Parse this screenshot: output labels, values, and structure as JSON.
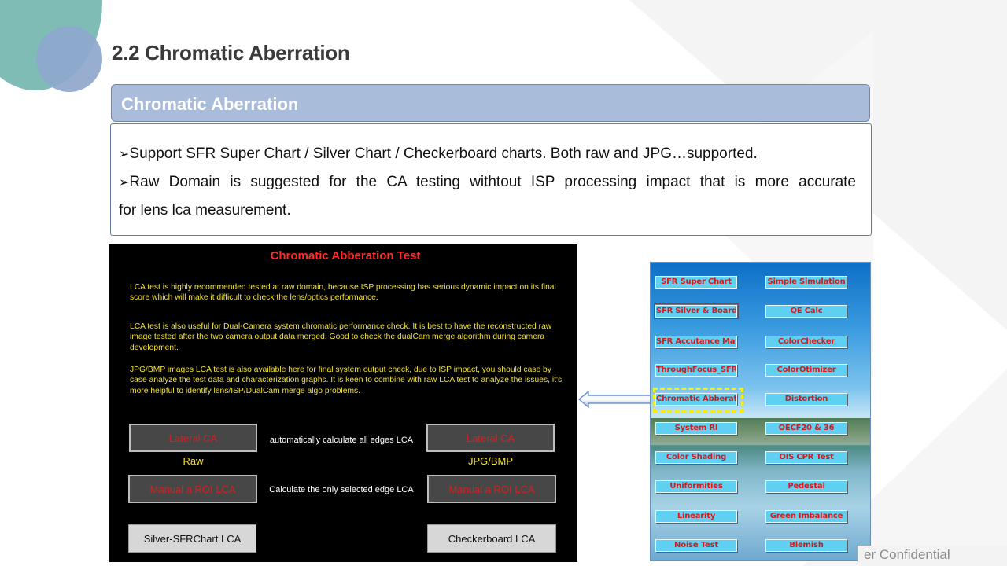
{
  "slide": {
    "title": "2.2  Chromatic Aberration",
    "section_header": "Chromatic Aberration",
    "bullets": [
      "Support SFR Super Chart / Silver Chart / Checkerboard charts. Both raw and JPG…supported.",
      "Raw Domain is suggested for the CA testing withtout ISP processing impact that is more accurate",
      "for lens lca measurement."
    ],
    "bullet_glyph": "➢",
    "footer_text": "er Confidential"
  },
  "app": {
    "title": "Chromatic Abberation Test",
    "paragraphs": [
      "LCA test is highly recommended tested at raw domain, because ISP processing has serious dynamic impact on its final score which will make it difficult to check the lens/optics performance.",
      "LCA test is also useful for Dual-Camera system chromatic performance check. It is best to have the reconstructed raw image tested after the two camera output data merged. Good to check the dualCam merge algorithm during camera development.",
      "JPG/BMP images LCA test is also available here for final system output check, due to ISP impact, you should case by case analyze the test data and characterization graphs.  It is keen to combine with raw LCA test to analyze the issues, it's more helpful to identify lens/ISP/DualCam merge algo problems."
    ],
    "buttons": {
      "lateral_raw": "Lateral CA",
      "lateral_jpg": "Lateral CA",
      "manual_raw": "Manual a ROI LCA",
      "manual_jpg": "Manual a ROI LCA",
      "silver": "Silver-SFRChart LCA",
      "checkerboard": "Checkerboard LCA"
    },
    "captions": {
      "raw": "Raw",
      "jpg": "JPG/BMP",
      "auto": "automatically calculate all edges LCA",
      "selected": "Calculate the only selected edge LCA"
    },
    "colors": {
      "title": "#ff2a2a",
      "text": "#f2e23a",
      "button_text": "#d62020"
    }
  },
  "launcher": {
    "left": [
      "SFR Super Chart",
      "SFR Silver & Boards",
      "SFR Accutance Map",
      "ThroughFocus_SFR",
      "Chromatic Abberation",
      "System RI",
      "Color Shading",
      "Uniformities",
      "Linearity",
      "Noise Test"
    ],
    "right": [
      "Simple Simulation",
      "QE Calc",
      "ColorChecker",
      "ColorOtimizer",
      "Distortion",
      "OECF20 & 36",
      "OIS CPR Test",
      "Pedestal",
      "Green Imbalance",
      "Blemish"
    ],
    "highlighted": "Chromatic Abberation",
    "colors": {
      "button_bg": "#5fd0f2",
      "button_text": "#d21b1b",
      "highlight": "#f2ee1c"
    }
  }
}
